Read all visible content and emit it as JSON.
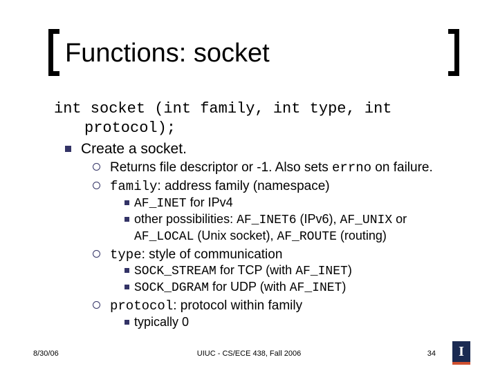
{
  "title": "Functions: socket",
  "signature": {
    "line1": "int socket (int family, int type, int",
    "line2": "protocol);"
  },
  "lvl1_create": "Create a socket.",
  "b1": {
    "pre": "Returns file descriptor or -1. Also sets ",
    "code": "errno",
    "post": " on failure."
  },
  "b2": {
    "code": "family",
    "post": ": address family (namespace)"
  },
  "b2s1": {
    "code": "AF_INET",
    "post": " for IPv4"
  },
  "b2s2": {
    "pre": "other possibilities: ",
    "c1": "AF_INET6",
    "mid1": " (IPv6), ",
    "c2": "AF_UNIX",
    "mid2": " or ",
    "c3": "AF_LOCAL",
    "line2a": " (Unix socket), ",
    "c4": "AF_ROUTE",
    "line2b": " (routing)"
  },
  "b3": {
    "code": "type",
    "post": ": style of communication"
  },
  "b3s1": {
    "c1": "SOCK_STREAM",
    "mid": " for TCP (with ",
    "c2": "AF_INET",
    "post": ")"
  },
  "b3s2": {
    "c1": "SOCK_DGRAM",
    "mid": " for UDP (with ",
    "c2": "AF_INET",
    "post": ")"
  },
  "b4": {
    "code": "protocol",
    "post": ": protocol within family"
  },
  "b4s1": "typically 0",
  "footer": {
    "date": "8/30/06",
    "center": "UIUC - CS/ECE 438, Fall 2006",
    "page": "34"
  },
  "logo_letter": "I"
}
